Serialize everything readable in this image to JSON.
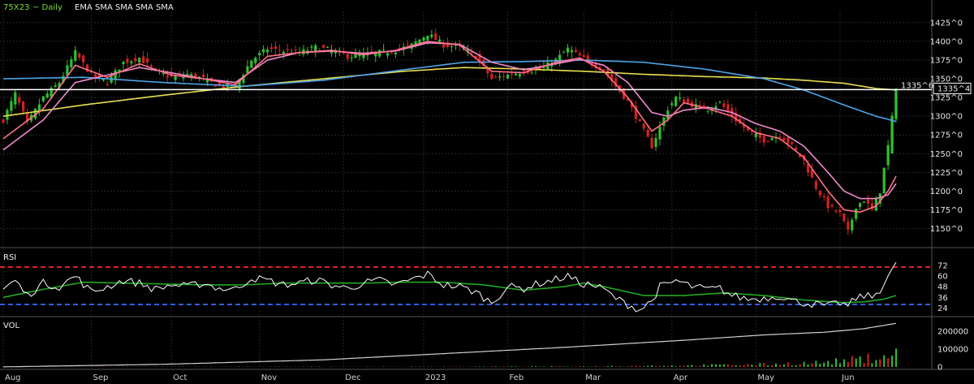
{
  "header": {
    "symbol": "75X23",
    "period": "~ Daily",
    "studies": "EMA SMA SMA SMA SMA"
  },
  "colors": {
    "background": "#000000",
    "up_candle": "#2fbf2f",
    "down_candle": "#d42020",
    "ema_fast": "#ff6f8a",
    "sma_slow": "#f08acb",
    "sma_blue": "#4ea3e6",
    "sma_yellow": "#e8e050",
    "hline": "#ffffff",
    "rsi_line": "#ffffff",
    "rsi_sma": "#22a822",
    "rsi_upper": "#e02020",
    "rsi_lower": "#2f5fe0",
    "vol_line": "#d0d0d0"
  },
  "price_pane": {
    "last_price_label": "1335^6",
    "axis_box_label": "1335^4",
    "hline_value": 1335.5
  },
  "rsi_pane": {
    "label": "RSI"
  },
  "vol_pane": {
    "label": "VOL"
  },
  "chart_data": {
    "type": "candlestick",
    "title": "",
    "x_labels": [
      "Aug",
      "Sep",
      "Oct",
      "Nov",
      "Dec",
      "2023",
      "Feb",
      "Mar",
      "Apr",
      "May",
      "Jun"
    ],
    "x_label_positions": [
      0,
      22,
      42,
      64,
      85,
      105,
      126,
      145,
      167,
      188,
      209
    ],
    "n_bars": 224,
    "price": {
      "ylim": [
        1130,
        1440
      ],
      "ticks": [
        "1425^0",
        "1400^0",
        "1375^0",
        "1350^0",
        "1325^0",
        "1300^0",
        "1275^0",
        "1250^0",
        "1225^0",
        "1200^0",
        "1175^0",
        "1150^0"
      ],
      "tick_values": [
        1425,
        1400,
        1375,
        1350,
        1325,
        1300,
        1275,
        1250,
        1225,
        1200,
        1175,
        1150
      ],
      "close_anchors": [
        [
          0,
          1295
        ],
        [
          3,
          1330
        ],
        [
          6,
          1290
        ],
        [
          10,
          1325
        ],
        [
          14,
          1345
        ],
        [
          18,
          1385
        ],
        [
          22,
          1355
        ],
        [
          26,
          1345
        ],
        [
          30,
          1372
        ],
        [
          34,
          1378
        ],
        [
          38,
          1360
        ],
        [
          42,
          1352
        ],
        [
          46,
          1356
        ],
        [
          50,
          1350
        ],
        [
          54,
          1340
        ],
        [
          58,
          1340
        ],
        [
          62,
          1375
        ],
        [
          66,
          1390
        ],
        [
          70,
          1387
        ],
        [
          74,
          1385
        ],
        [
          78,
          1392
        ],
        [
          82,
          1388
        ],
        [
          86,
          1380
        ],
        [
          90,
          1382
        ],
        [
          94,
          1385
        ],
        [
          98,
          1388
        ],
        [
          102,
          1395
        ],
        [
          106,
          1410
        ],
        [
          110,
          1395
        ],
        [
          114,
          1392
        ],
        [
          118,
          1380
        ],
        [
          122,
          1350
        ],
        [
          126,
          1355
        ],
        [
          130,
          1360
        ],
        [
          134,
          1362
        ],
        [
          138,
          1375
        ],
        [
          141,
          1390
        ],
        [
          144,
          1380
        ],
        [
          147,
          1370
        ],
        [
          150,
          1362
        ],
        [
          153,
          1340
        ],
        [
          156,
          1320
        ],
        [
          159,
          1290
        ],
        [
          162,
          1260
        ],
        [
          164,
          1285
        ],
        [
          166,
          1310
        ],
        [
          168,
          1325
        ],
        [
          172,
          1315
        ],
        [
          176,
          1310
        ],
        [
          179,
          1318
        ],
        [
          182,
          1300
        ],
        [
          186,
          1280
        ],
        [
          190,
          1268
        ],
        [
          194,
          1275
        ],
        [
          197,
          1260
        ],
        [
          200,
          1240
        ],
        [
          203,
          1205
        ],
        [
          206,
          1180
        ],
        [
          209,
          1170
        ],
        [
          211,
          1145
        ],
        [
          213,
          1180
        ],
        [
          215,
          1188
        ],
        [
          217,
          1175
        ],
        [
          219,
          1200
        ],
        [
          221,
          1260
        ],
        [
          223,
          1335
        ]
      ],
      "ema_fast_anchors": [
        [
          0,
          1270
        ],
        [
          10,
          1310
        ],
        [
          18,
          1368
        ],
        [
          26,
          1352
        ],
        [
          34,
          1370
        ],
        [
          42,
          1355
        ],
        [
          50,
          1350
        ],
        [
          58,
          1342
        ],
        [
          66,
          1380
        ],
        [
          74,
          1385
        ],
        [
          82,
          1388
        ],
        [
          90,
          1382
        ],
        [
          98,
          1388
        ],
        [
          106,
          1400
        ],
        [
          114,
          1395
        ],
        [
          122,
          1360
        ],
        [
          130,
          1358
        ],
        [
          138,
          1372
        ],
        [
          144,
          1378
        ],
        [
          150,
          1360
        ],
        [
          156,
          1325
        ],
        [
          162,
          1280
        ],
        [
          166,
          1295
        ],
        [
          170,
          1318
        ],
        [
          176,
          1310
        ],
        [
          182,
          1300
        ],
        [
          188,
          1278
        ],
        [
          194,
          1270
        ],
        [
          200,
          1245
        ],
        [
          206,
          1200
        ],
        [
          210,
          1175
        ],
        [
          214,
          1172
        ],
        [
          218,
          1180
        ],
        [
          221,
          1200
        ],
        [
          223,
          1220
        ]
      ],
      "sma_slow_anchors": [
        [
          0,
          1255
        ],
        [
          10,
          1295
        ],
        [
          18,
          1345
        ],
        [
          26,
          1355
        ],
        [
          34,
          1365
        ],
        [
          42,
          1358
        ],
        [
          50,
          1350
        ],
        [
          58,
          1345
        ],
        [
          66,
          1375
        ],
        [
          74,
          1385
        ],
        [
          82,
          1387
        ],
        [
          90,
          1384
        ],
        [
          98,
          1387
        ],
        [
          106,
          1398
        ],
        [
          114,
          1396
        ],
        [
          122,
          1372
        ],
        [
          130,
          1362
        ],
        [
          138,
          1370
        ],
        [
          144,
          1376
        ],
        [
          150,
          1368
        ],
        [
          156,
          1345
        ],
        [
          162,
          1305
        ],
        [
          166,
          1300
        ],
        [
          170,
          1308
        ],
        [
          176,
          1312
        ],
        [
          182,
          1305
        ],
        [
          188,
          1290
        ],
        [
          194,
          1280
        ],
        [
          200,
          1260
        ],
        [
          206,
          1225
        ],
        [
          210,
          1200
        ],
        [
          214,
          1190
        ],
        [
          218,
          1190
        ],
        [
          221,
          1195
        ],
        [
          223,
          1210
        ]
      ],
      "sma_blue_anchors": [
        [
          0,
          1350
        ],
        [
          20,
          1352
        ],
        [
          40,
          1345
        ],
        [
          60,
          1340
        ],
        [
          80,
          1348
        ],
        [
          100,
          1362
        ],
        [
          115,
          1372
        ],
        [
          130,
          1373
        ],
        [
          145,
          1375
        ],
        [
          160,
          1372
        ],
        [
          175,
          1363
        ],
        [
          190,
          1350
        ],
        [
          200,
          1335
        ],
        [
          210,
          1315
        ],
        [
          218,
          1300
        ],
        [
          223,
          1293
        ]
      ],
      "sma_yellow_anchors": [
        [
          0,
          1300
        ],
        [
          20,
          1315
        ],
        [
          40,
          1328
        ],
        [
          60,
          1340
        ],
        [
          80,
          1350
        ],
        [
          100,
          1360
        ],
        [
          115,
          1365
        ],
        [
          130,
          1363
        ],
        [
          145,
          1360
        ],
        [
          160,
          1356
        ],
        [
          175,
          1353
        ],
        [
          190,
          1351
        ],
        [
          200,
          1348
        ],
        [
          210,
          1344
        ],
        [
          218,
          1337
        ],
        [
          223,
          1335
        ]
      ]
    },
    "rsi": {
      "ylim": [
        18,
        80
      ],
      "ticks": [
        "72",
        "60",
        "48",
        "36",
        "24"
      ],
      "tick_values": [
        72,
        60,
        48,
        36,
        24
      ],
      "upper_level": 70,
      "lower_level": 28,
      "rsi_anchors": [
        [
          0,
          45
        ],
        [
          3,
          55
        ],
        [
          6,
          38
        ],
        [
          10,
          52
        ],
        [
          14,
          48
        ],
        [
          18,
          60
        ],
        [
          22,
          42
        ],
        [
          26,
          48
        ],
        [
          30,
          55
        ],
        [
          34,
          52
        ],
        [
          38,
          45
        ],
        [
          42,
          50
        ],
        [
          46,
          48
        ],
        [
          50,
          52
        ],
        [
          54,
          46
        ],
        [
          58,
          45
        ],
        [
          62,
          58
        ],
        [
          66,
          55
        ],
        [
          70,
          50
        ],
        [
          74,
          52
        ],
        [
          78,
          56
        ],
        [
          82,
          50
        ],
        [
          86,
          46
        ],
        [
          90,
          52
        ],
        [
          94,
          55
        ],
        [
          98,
          50
        ],
        [
          102,
          56
        ],
        [
          106,
          62
        ],
        [
          110,
          50
        ],
        [
          114,
          48
        ],
        [
          118,
          42
        ],
        [
          122,
          30
        ],
        [
          126,
          48
        ],
        [
          130,
          46
        ],
        [
          134,
          52
        ],
        [
          138,
          56
        ],
        [
          141,
          60
        ],
        [
          144,
          52
        ],
        [
          147,
          50
        ],
        [
          150,
          45
        ],
        [
          153,
          35
        ],
        [
          156,
          28
        ],
        [
          159,
          22
        ],
        [
          162,
          32
        ],
        [
          164,
          48
        ],
        [
          166,
          50
        ],
        [
          168,
          55
        ],
        [
          172,
          48
        ],
        [
          176,
          45
        ],
        [
          179,
          46
        ],
        [
          182,
          38
        ],
        [
          186,
          34
        ],
        [
          190,
          35
        ],
        [
          194,
          38
        ],
        [
          197,
          32
        ],
        [
          200,
          30
        ],
        [
          203,
          28
        ],
        [
          206,
          26
        ],
        [
          209,
          30
        ],
        [
          211,
          26
        ],
        [
          213,
          35
        ],
        [
          215,
          38
        ],
        [
          217,
          36
        ],
        [
          219,
          45
        ],
        [
          221,
          60
        ],
        [
          223,
          72
        ]
      ],
      "rsi_sma_anchors": [
        [
          0,
          36
        ],
        [
          10,
          45
        ],
        [
          20,
          53
        ],
        [
          30,
          52
        ],
        [
          40,
          51
        ],
        [
          50,
          50
        ],
        [
          60,
          50
        ],
        [
          70,
          52
        ],
        [
          80,
          52
        ],
        [
          90,
          52
        ],
        [
          100,
          53
        ],
        [
          110,
          53
        ],
        [
          120,
          50
        ],
        [
          130,
          44
        ],
        [
          140,
          48
        ],
        [
          145,
          52
        ],
        [
          150,
          48
        ],
        [
          160,
          38
        ],
        [
          170,
          38
        ],
        [
          180,
          41
        ],
        [
          190,
          38
        ],
        [
          200,
          33
        ],
        [
          210,
          30
        ],
        [
          215,
          31
        ],
        [
          220,
          34
        ],
        [
          223,
          38
        ]
      ]
    },
    "volume": {
      "ylim": [
        0,
        260000
      ],
      "ticks": [
        "200000",
        "100000",
        "0"
      ],
      "tick_values": [
        200000,
        100000,
        0
      ],
      "cum_anchors": [
        [
          0,
          500
        ],
        [
          40,
          15000
        ],
        [
          80,
          40000
        ],
        [
          110,
          75000
        ],
        [
          140,
          110000
        ],
        [
          170,
          150000
        ],
        [
          190,
          180000
        ],
        [
          205,
          195000
        ],
        [
          215,
          215000
        ],
        [
          223,
          245000
        ]
      ],
      "bar_anchors": [
        [
          0,
          1000
        ],
        [
          100,
          1500
        ],
        [
          140,
          3000
        ],
        [
          170,
          8000
        ],
        [
          190,
          14000
        ],
        [
          205,
          25000
        ],
        [
          215,
          45000
        ],
        [
          223,
          75000
        ]
      ]
    }
  }
}
